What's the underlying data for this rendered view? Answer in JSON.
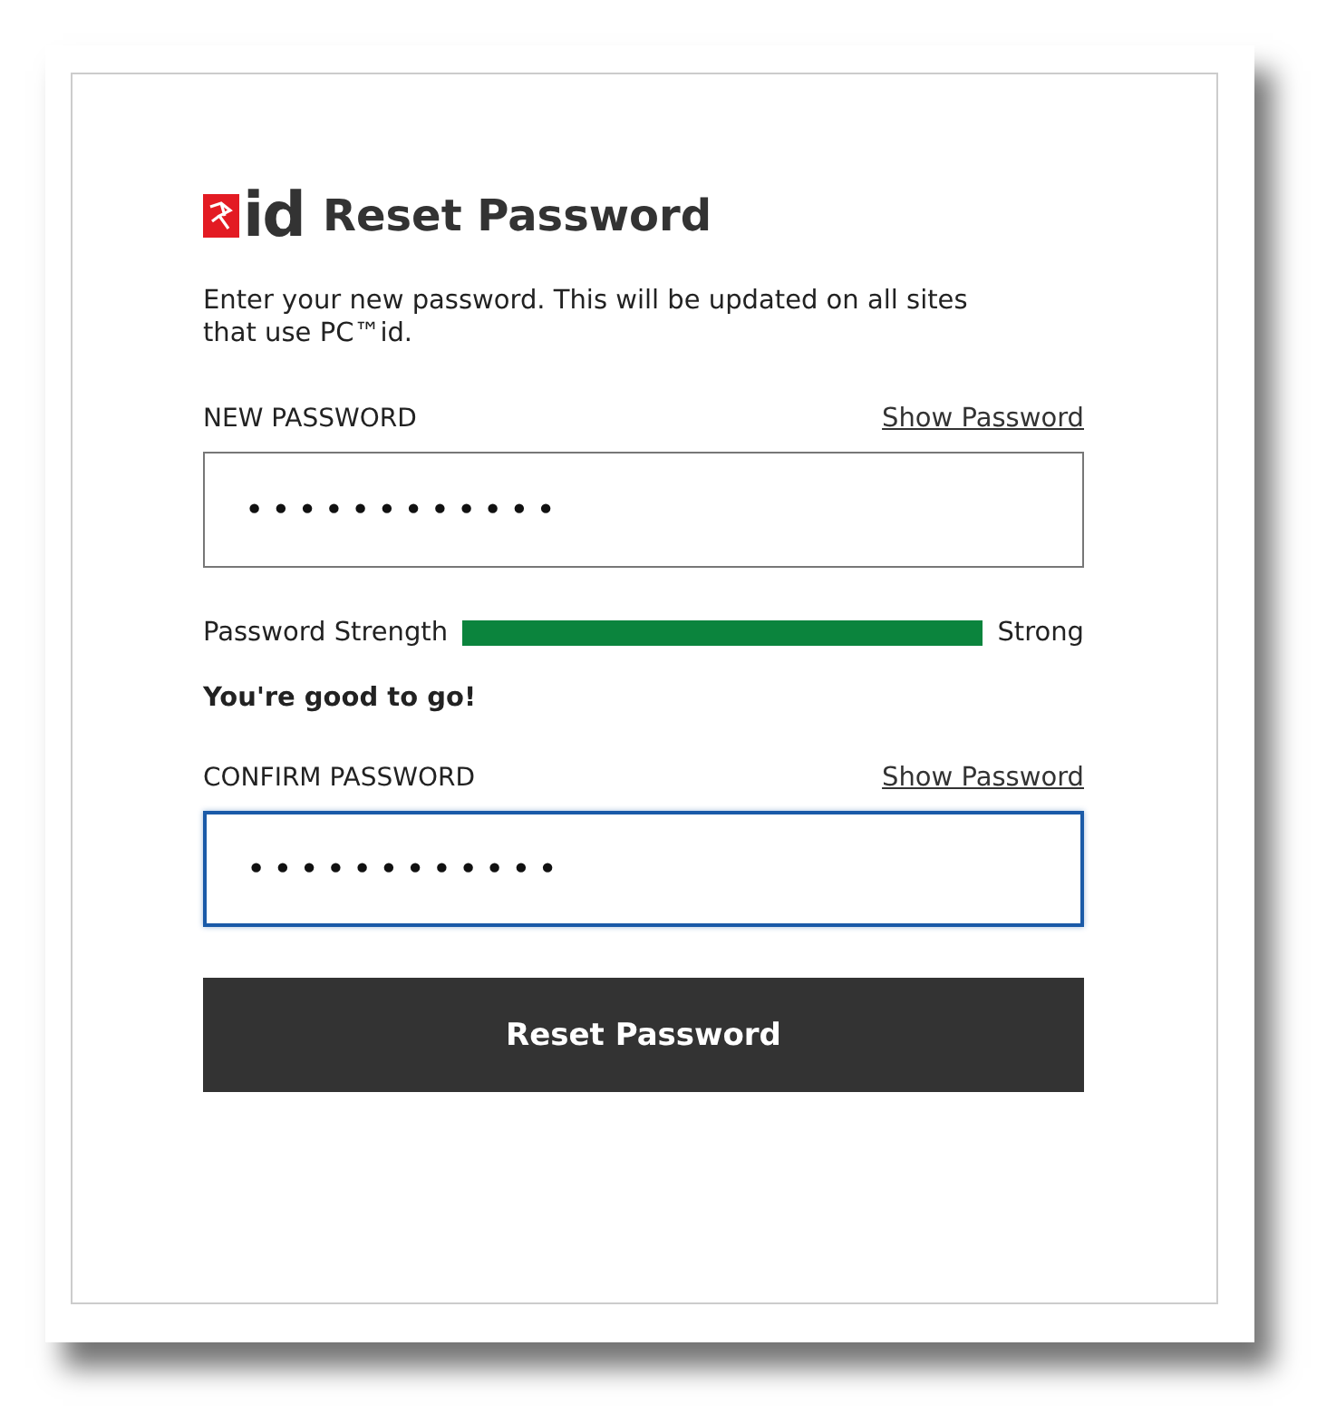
{
  "header": {
    "logo_text": "id",
    "title": "Reset Password"
  },
  "intro": "Enter your new password. This will be updated on all sites that use PC™id.",
  "fields": [
    {
      "label": "NEW PASSWORD",
      "toggle": "Show Password",
      "value": "••••••••••••",
      "focused": false
    },
    {
      "label": "CONFIRM PASSWORD",
      "toggle": "Show Password",
      "value": "••••••••••••",
      "focused": true
    }
  ],
  "strength": {
    "label": "Password Strength",
    "level": 1,
    "reading": "Strong",
    "message": "You're good to go!"
  },
  "submit": "Reset Password"
}
